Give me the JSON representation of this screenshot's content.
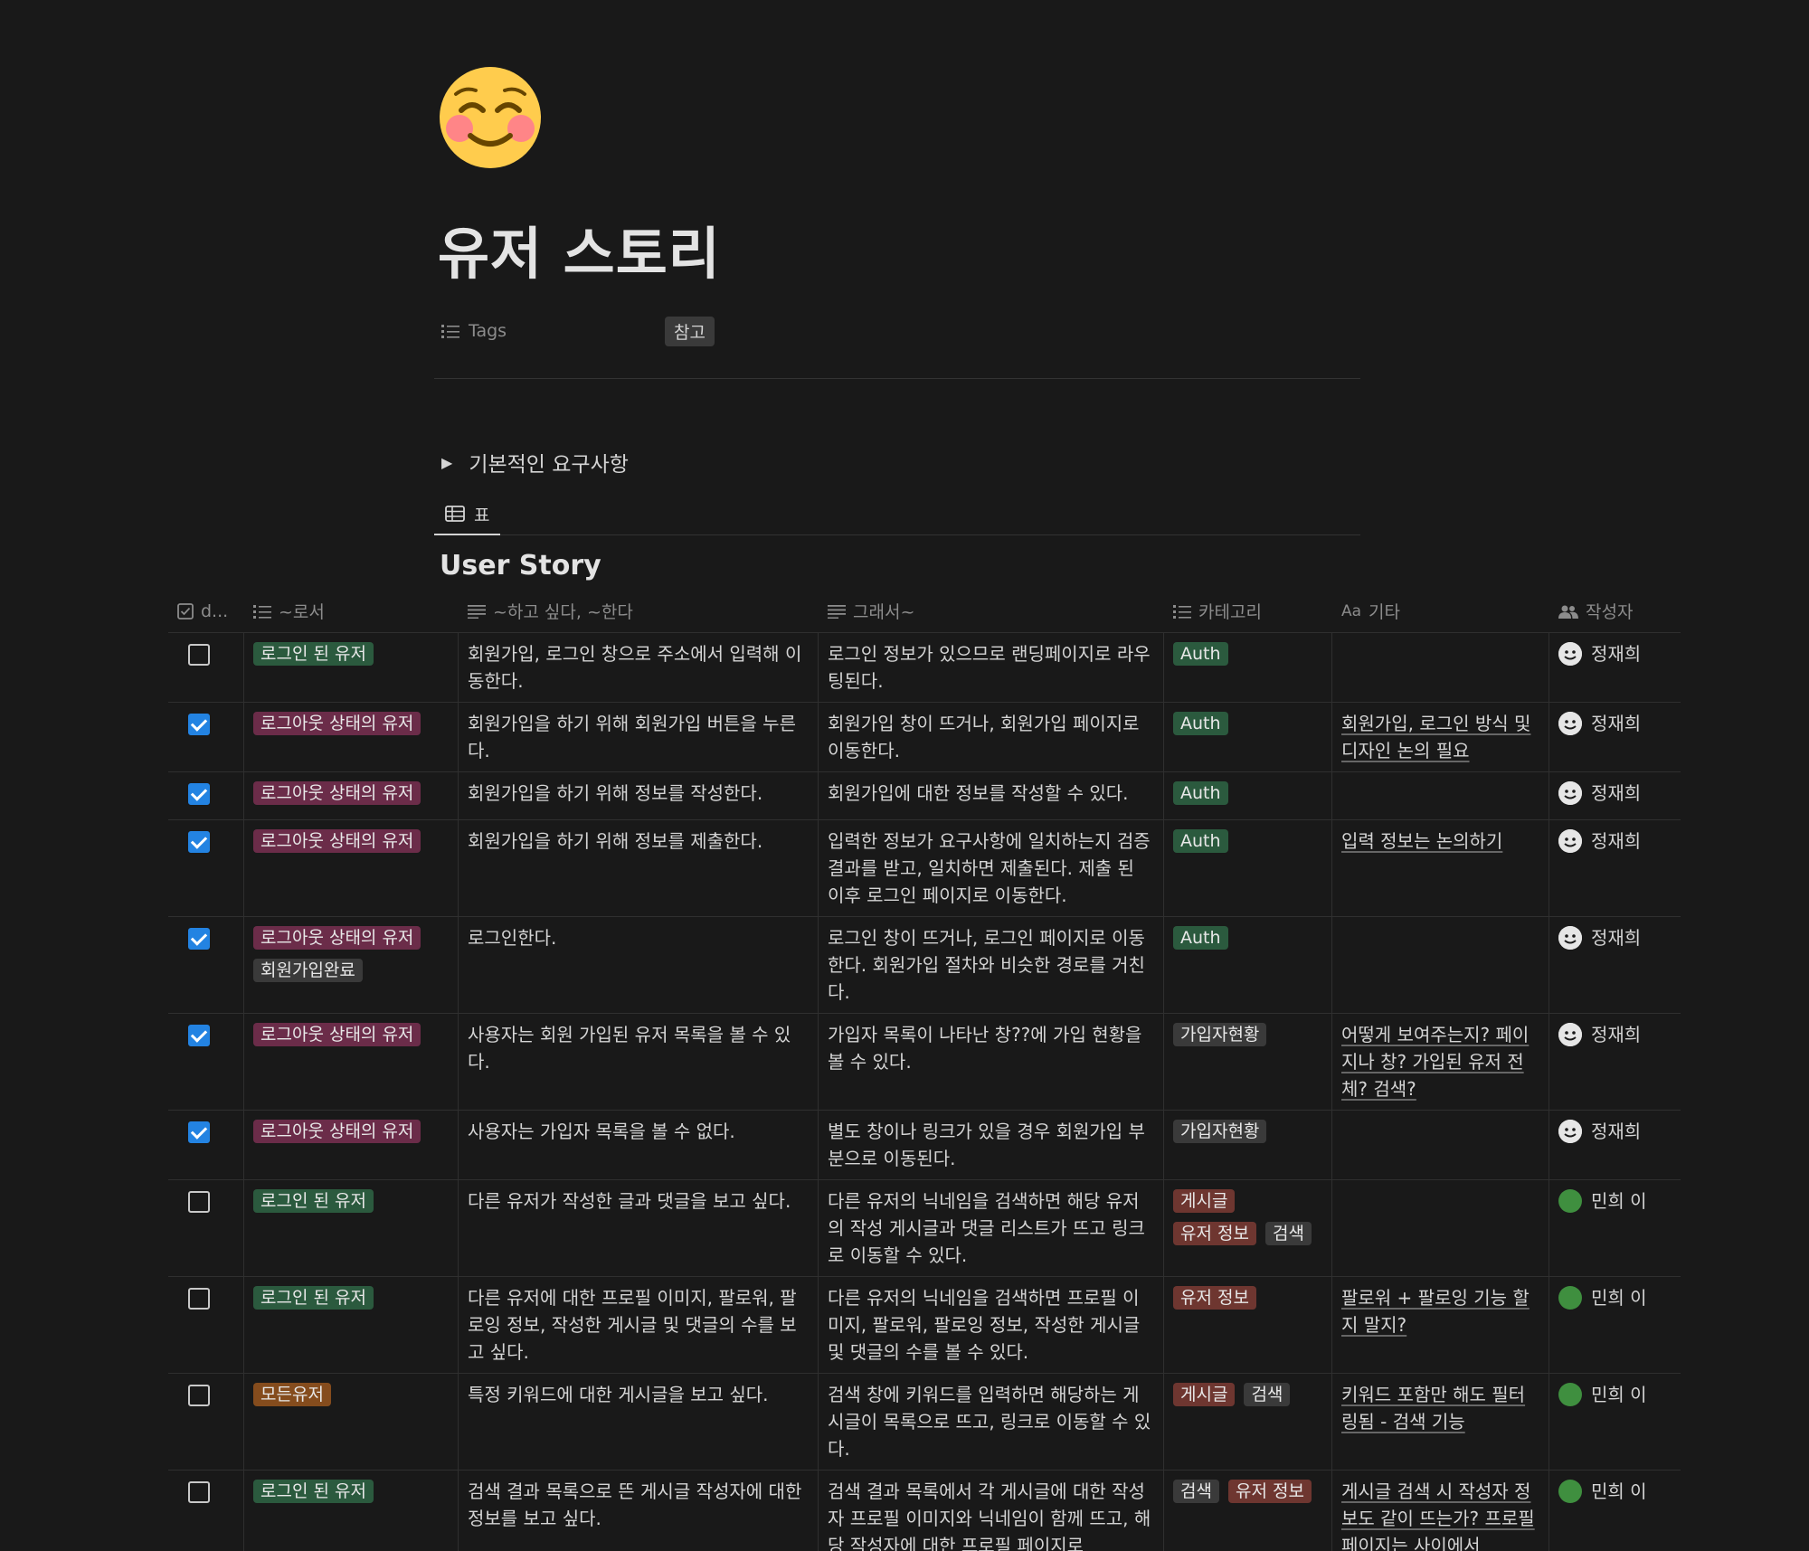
{
  "page": {
    "title": "유저 스토리",
    "property_label": "Tags",
    "property_value": "참고",
    "toggle_label": "기본적인 요구사항",
    "view_tab": "표",
    "db_title": "User Story"
  },
  "columns": [
    {
      "label": "d...",
      "icon": "checkbox-icon"
    },
    {
      "label": "~로서",
      "icon": "list-icon"
    },
    {
      "label": "~하고 싶다, ~한다",
      "icon": "text-icon"
    },
    {
      "label": "그래서~",
      "icon": "text-icon"
    },
    {
      "label": "카테고리",
      "icon": "list-icon"
    },
    {
      "label": "기타",
      "icon": "title-icon",
      "prefix": "Aa"
    },
    {
      "label": "작성자",
      "icon": "people-icon"
    }
  ],
  "tag_colors": {
    "green": "#2b5a3e",
    "pink": "#6b2c49",
    "gray": "#3a3a3a",
    "orange": "#854c1d",
    "red": "#6e3630"
  },
  "rows": [
    {
      "done": false,
      "role": [
        {
          "text": "로그인 된 유저",
          "color": "green"
        }
      ],
      "want": "회원가입, 로그인 창으로 주소에서 입력해 이동한다.",
      "so": "로그인 정보가 있으므로 랜딩페이지로 라우팅된다.",
      "category": [
        {
          "text": "Auth",
          "color": "green"
        }
      ],
      "etc": "",
      "author": "정재희",
      "avatar": "face"
    },
    {
      "done": true,
      "role": [
        {
          "text": "로그아웃 상태의 유저",
          "color": "pink"
        }
      ],
      "want": "회원가입을 하기 위해 회원가입 버튼을 누른다.",
      "so": "회원가입 창이 뜨거나, 회원가입 페이지로 이동한다.",
      "category": [
        {
          "text": "Auth",
          "color": "green"
        }
      ],
      "etc": "회원가입, 로그인 방식 및 디자인 논의 필요",
      "author": "정재희",
      "avatar": "face"
    },
    {
      "done": true,
      "role": [
        {
          "text": "로그아웃 상태의 유저",
          "color": "pink"
        }
      ],
      "want": "회원가입을 하기 위해 정보를 작성한다.",
      "so": "회원가입에 대한 정보를 작성할 수 있다.",
      "category": [
        {
          "text": "Auth",
          "color": "green"
        }
      ],
      "etc": "",
      "author": "정재희",
      "avatar": "face"
    },
    {
      "done": true,
      "role": [
        {
          "text": "로그아웃 상태의 유저",
          "color": "pink"
        }
      ],
      "want": "회원가입을 하기 위해 정보를 제출한다.",
      "so": "입력한 정보가 요구사항에 일치하는지 검증결과를 받고, 일치하면 제출된다. 제출 된 이후 로그인 페이지로 이동한다.",
      "category": [
        {
          "text": "Auth",
          "color": "green"
        }
      ],
      "etc": "입력 정보는 논의하기",
      "author": "정재희",
      "avatar": "face"
    },
    {
      "done": true,
      "role": [
        {
          "text": "로그아웃 상태의 유저",
          "color": "pink"
        },
        {
          "text": "회원가입완료",
          "color": "gray"
        }
      ],
      "want": "로그인한다.",
      "so": "로그인 창이 뜨거나, 로그인 페이지로 이동한다. 회원가입 절차와 비슷한 경로를 거친다.",
      "category": [
        {
          "text": "Auth",
          "color": "green"
        }
      ],
      "etc": "",
      "author": "정재희",
      "avatar": "face"
    },
    {
      "done": true,
      "role": [
        {
          "text": "로그아웃 상태의 유저",
          "color": "pink"
        }
      ],
      "want": "사용자는 회원 가입된 유저 목록을 볼 수 있다.",
      "so": "가입자 목록이 나타난 창??에 가입 현황을 볼 수 있다.",
      "category": [
        {
          "text": "가입자현황",
          "color": "gray"
        }
      ],
      "etc": "어떻게 보여주는지? 페이지나 창? 가입된 유저 전체? 검색?",
      "author": "정재희",
      "avatar": "face"
    },
    {
      "done": true,
      "role": [
        {
          "text": "로그아웃 상태의 유저",
          "color": "pink"
        }
      ],
      "want": "사용자는 가입자 목록을 볼 수 없다.",
      "so": "별도 창이나 링크가 있을 경우 회원가입 부분으로 이동된다.",
      "category": [
        {
          "text": "가입자현황",
          "color": "gray"
        }
      ],
      "etc": "",
      "author": "정재희",
      "avatar": "face"
    },
    {
      "done": false,
      "role": [
        {
          "text": "로그인 된 유저",
          "color": "green"
        }
      ],
      "want": "다른 유저가 작성한 글과 댓글을 보고 싶다.",
      "so": "다른 유저의 닉네임을 검색하면 해당 유저의 작성 게시글과 댓글 리스트가 뜨고 링크로 이동할 수 있다.",
      "category": [
        {
          "text": "게시글",
          "color": "red"
        },
        {
          "text": "유저 정보",
          "color": "red"
        },
        {
          "text": "검색",
          "color": "gray"
        }
      ],
      "etc": "",
      "author": "민희 이",
      "avatar": "green"
    },
    {
      "done": false,
      "role": [
        {
          "text": "로그인 된 유저",
          "color": "green"
        }
      ],
      "want": "다른 유저에 대한 프로필 이미지, 팔로워, 팔로잉 정보, 작성한 게시글 및 댓글의 수를 보고 싶다.",
      "so": "다른 유저의 닉네임을 검색하면 프로필 이미지, 팔로워, 팔로잉 정보, 작성한 게시글 및 댓글의 수를 볼 수 있다.",
      "category": [
        {
          "text": "유저 정보",
          "color": "red"
        }
      ],
      "etc": "팔로워 + 팔로잉 기능 할지 말지?",
      "author": "민희 이",
      "avatar": "green"
    },
    {
      "done": false,
      "role": [
        {
          "text": "모든유저",
          "color": "orange"
        }
      ],
      "want": "특정 키워드에 대한 게시글을 보고 싶다.",
      "so": "검색 창에 키워드를 입력하면 해당하는 게시글이 목록으로 뜨고, 링크로 이동할 수 있다.",
      "category": [
        {
          "text": "게시글",
          "color": "red"
        },
        {
          "text": "검색",
          "color": "gray"
        }
      ],
      "etc": "키워드 포함만 해도 필터링됨 - 검색 기능",
      "author": "민희 이",
      "avatar": "green"
    },
    {
      "done": false,
      "role": [
        {
          "text": "로그인 된 유저",
          "color": "green"
        }
      ],
      "want": "검색 결과 목록으로 뜬 게시글 작성자에 대한 정보를 보고 싶다.",
      "so": "검색 결과 목록에서 각 게시글에 대한 작성자 프로필 이미지와 닉네임이 함께 뜨고, 해당 작성자에 대한 프로필 페이지로",
      "category": [
        {
          "text": "검색",
          "color": "gray"
        },
        {
          "text": "유저 정보",
          "color": "red"
        }
      ],
      "etc": "게시글 검색 시 작성자 정보도 같이 뜨는가? 프로필 페이지는 사이에서",
      "author": "민희 이",
      "avatar": "green"
    }
  ]
}
